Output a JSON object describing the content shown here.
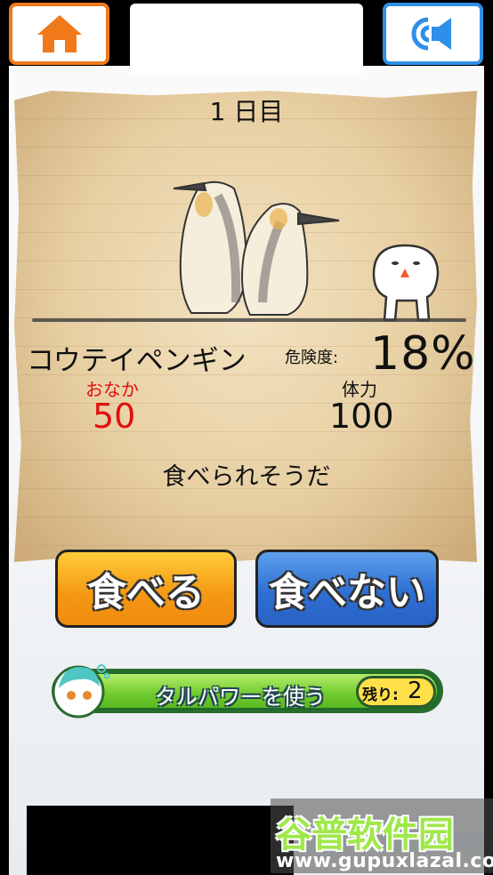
{
  "toolbar": {
    "home_icon": "home-icon",
    "sound_icon": "speaker-icon",
    "home_color": "#f07a1a",
    "sound_color": "#2f8fe8"
  },
  "paper": {
    "day": "1 日目",
    "animal_name": "コウテイペンギン",
    "danger_label": "危険度:",
    "danger_value": "18%",
    "hunger_label": "おなか",
    "hunger_value": "50",
    "stamina_label": "体力",
    "stamina_value": "100",
    "status_message": "食べられそうだ"
  },
  "actions": {
    "eat_label": "食べる",
    "not_eat_label": "食べない",
    "eat_color": "#f59a14",
    "not_eat_color": "#2e6fd4"
  },
  "power": {
    "label": "タルパワーを使う",
    "remaining_label": "残り:",
    "remaining_value": "2"
  },
  "watermark": {
    "title": "谷普软件园",
    "url": "www.gupuxlazal.com"
  }
}
